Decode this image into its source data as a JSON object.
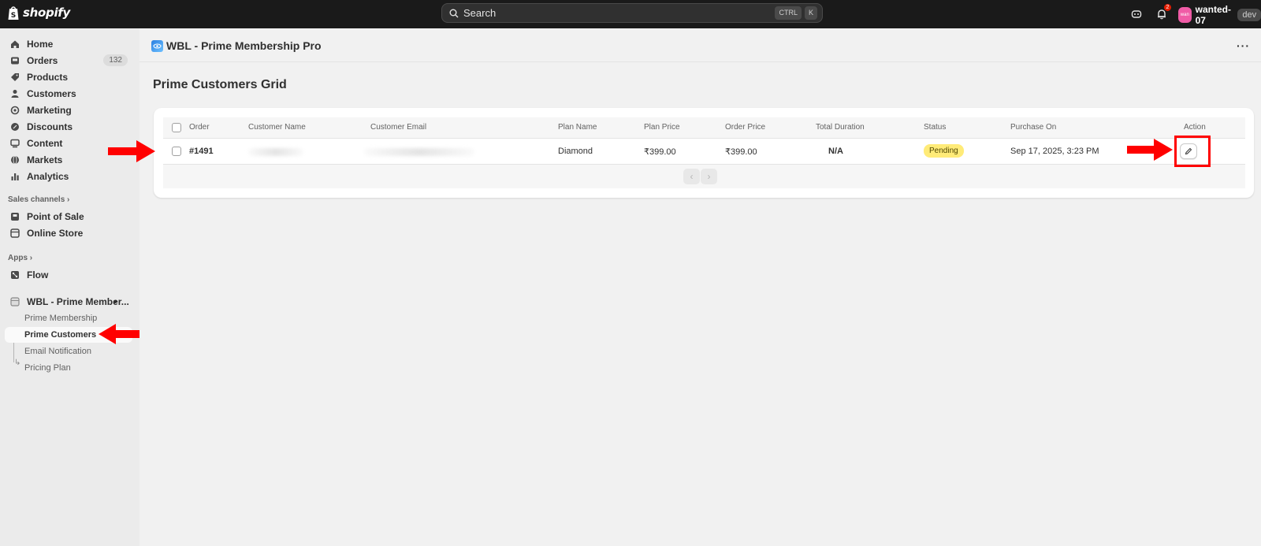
{
  "topbar": {
    "logo_text": "shopify",
    "search_placeholder": "Search",
    "search_keys": [
      "CTRL",
      "K"
    ],
    "notification_count": "2",
    "avatar_initials": "wan",
    "store_name": "wanted-07",
    "env_badge": "dev"
  },
  "sidebar": {
    "main_items": [
      {
        "label": "Home",
        "icon": "home-icon"
      },
      {
        "label": "Orders",
        "icon": "inbox-icon",
        "badge": "132"
      },
      {
        "label": "Products",
        "icon": "tag-icon"
      },
      {
        "label": "Customers",
        "icon": "person-icon"
      },
      {
        "label": "Marketing",
        "icon": "target-icon"
      },
      {
        "label": "Discounts",
        "icon": "discount-icon"
      },
      {
        "label": "Content",
        "icon": "content-icon"
      },
      {
        "label": "Markets",
        "icon": "globe-icon"
      },
      {
        "label": "Analytics",
        "icon": "bar-chart-icon"
      }
    ],
    "sales_channels_label": "Sales channels",
    "sales_channels": [
      {
        "label": "Point of Sale",
        "icon": "pos-icon"
      },
      {
        "label": "Online Store",
        "icon": "store-icon"
      }
    ],
    "apps_label": "Apps",
    "apps": [
      {
        "label": "Flow",
        "icon": "flow-icon"
      }
    ],
    "app_group": {
      "label": "WBL - Prime Member...",
      "sub_items": [
        "Prime Membership",
        "Prime Customers",
        "Email Notification",
        "Pricing Plan"
      ],
      "active": "Prime Customers"
    }
  },
  "main": {
    "app_title": "WBL - Prime Membership Pro",
    "more_label": "···",
    "page_title": "Prime Customers Grid",
    "table": {
      "columns": [
        "Order",
        "Customer Name",
        "Customer Email",
        "Plan Name",
        "Plan Price",
        "Order Price",
        "Total Duration",
        "Status",
        "Purchase On",
        "Action"
      ],
      "rows": [
        {
          "order": "#1491",
          "customer_name": "",
          "customer_email": "",
          "plan_name": "Diamond",
          "plan_price": "₹399.00",
          "order_price": "₹399.00",
          "total_duration": "N/A",
          "status": "Pending",
          "purchase_on": "Sep 17, 2025, 3:23 PM"
        }
      ]
    },
    "pagination": {
      "prev": "‹",
      "next": "›"
    }
  },
  "colors": {
    "topbar_bg": "#1a1a1a",
    "sidebar_bg": "#ebebeb",
    "page_bg": "#f1f1f1",
    "pending_badge": "#ffeb78",
    "annotation_red": "#ff0000"
  }
}
